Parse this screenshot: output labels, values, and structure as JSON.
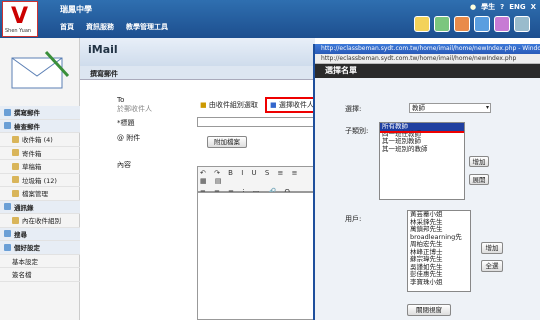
{
  "header": {
    "school": "瑞鳳中學",
    "logo_text": "Shen Yuan",
    "nav": [
      "首頁",
      "資訊服務",
      "教學管理工具"
    ],
    "user": "學生",
    "lang": [
      "ENG",
      "X"
    ]
  },
  "imail": {
    "title": "iMail",
    "compose_header": "撰寫郵件"
  },
  "sidebar": [
    {
      "label": "撰寫郵件",
      "type": "hd"
    },
    {
      "label": "檢查郵件",
      "type": "hd"
    },
    {
      "label": "收件箱 (4)",
      "type": "sub"
    },
    {
      "label": "寄件箱",
      "type": "sub"
    },
    {
      "label": "草稿箱",
      "type": "sub"
    },
    {
      "label": "垃圾箱 (12)",
      "type": "sub"
    },
    {
      "label": "檔案管理",
      "type": "sub"
    },
    {
      "label": "通訊錄",
      "type": "hd"
    },
    {
      "label": "內在收件組別",
      "type": "sub"
    },
    {
      "label": "搜尋",
      "type": "hd"
    },
    {
      "label": "個好設定",
      "type": "hd"
    },
    {
      "label": "基本設定",
      "type": "sub"
    },
    {
      "label": "簽名檔",
      "type": "sub"
    }
  ],
  "form": {
    "to_label": "To",
    "to_placeholder": "於郵收件人",
    "group_select": "由收件組別選取",
    "select_recipient": "選擇收件人",
    "subject_label": "*標題",
    "attach_label": "附件",
    "attach_button": "附加檔案",
    "content_label": "內容"
  },
  "popup": {
    "window_title": "http://eclassbeman.sydt.com.tw/home/imail/home/newIndex.php - Windows Internet",
    "url": "http://eclassbeman.sydt.com.tw/home/imail/home/newIndex.php",
    "title": "選擇名單",
    "category_label": "選擇:",
    "category_value": "教師",
    "subcat_label": "子類別:",
    "subcats": [
      "所有教師",
      "四一班任教師",
      "其一班別教師",
      "其一班別的教師"
    ],
    "add_button": "增加",
    "expand_button": "展開",
    "user_label": "用戶:",
    "users": [
      "黃芸蓁小姐",
      "林采鋒先生",
      "萬鎮邦先生",
      "broadlearning先",
      "周柏宏先生",
      "林峰正博士",
      "蘇宗瑋先生",
      "吳謹如先生",
      "彭佳惠先生",
      "李寶珠小姐"
    ],
    "add_button2": "增加",
    "select_all_button": "全選",
    "close_button": "關閉視窗"
  }
}
